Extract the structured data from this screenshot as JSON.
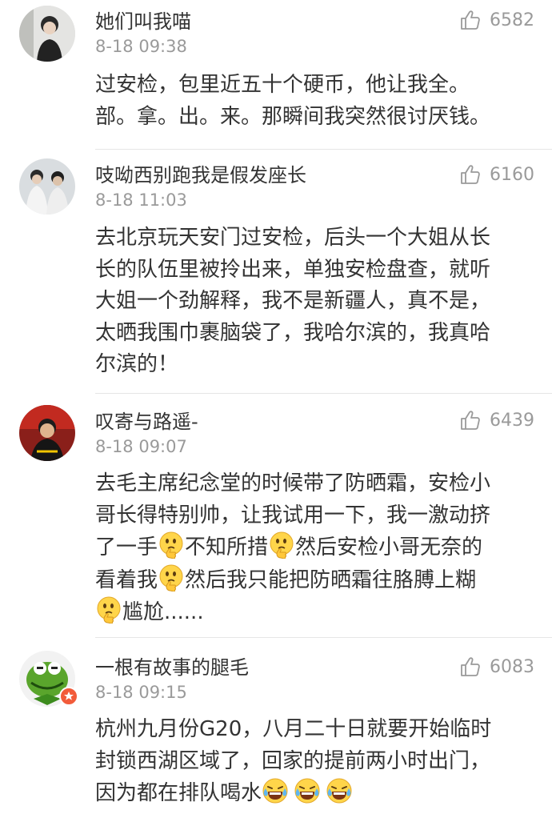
{
  "comments": [
    {
      "username": "她们叫我喵",
      "time": "8-18 09:38",
      "likes": "6582",
      "lines": [
        "过安检，包里近五十个硬币，他让我全。",
        "部。拿。出。来。那瞬间我突然很讨厌钱。"
      ]
    },
    {
      "username": "吱呦西别跑我是假发座长",
      "time": "8-18 11:03",
      "likes": "6160",
      "lines": [
        "去北京玩天安门过安检，后头一个大姐从长",
        "长的队伍里被拎出来，单独安检盘查，就听",
        "大姐一个劲解释，我不是新疆人，真不是，",
        "太晒我围巾裹脑袋了，我哈尔滨的，我真哈",
        "尔滨的！"
      ]
    },
    {
      "username": "叹寄与路遥-",
      "time": "8-18 09:07",
      "likes": "6439",
      "lines": [
        "去毛主席纪念堂的时候带了防晒霜，安检小",
        "哥长得特别帅，让我试用一下，我一激动挤",
        "了一手",
        "不知所措",
        "然后安检小哥无奈的",
        "看着我",
        "然后我只能把防晒霜往胳膊上糊",
        "尴尬......"
      ]
    },
    {
      "username": "一根有故事的腿毛",
      "time": "8-18 09:15",
      "likes": "6083",
      "lines": [
        "杭州九月份G20，八月二十日就要开始临时",
        "封锁西湖区域了，回家的提前两小时出门，",
        "因为都在排队喝水"
      ]
    }
  ],
  "emojis": {
    "thinking": "thinking-emoji",
    "laugh_cry": "laugh-cry-emoji"
  },
  "colors": {
    "text": "#333333",
    "meta": "#9a9a9a",
    "divider": "#e6e6e6",
    "badge": "#f25b3a"
  }
}
